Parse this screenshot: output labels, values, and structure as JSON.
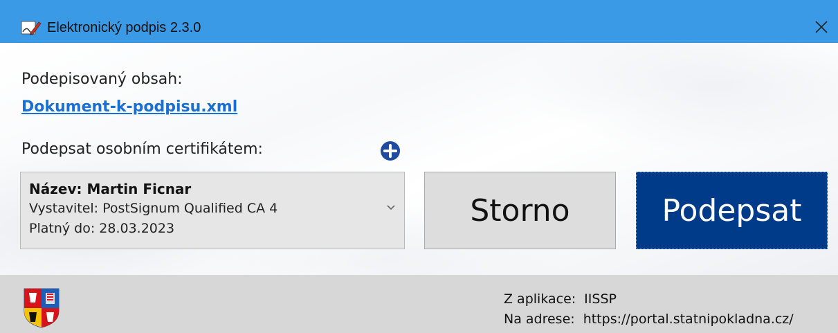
{
  "window": {
    "title": "Elektronický podpis 2.3.0",
    "titlebar_color": "#3b9ae6",
    "app_icon": "signature-pen-icon",
    "close_icon": "close-icon"
  },
  "content": {
    "signed_content_label": "Podepisovaný obsah:",
    "document_link": "Dokument-k-podpisu.xml",
    "certificate_label": "Podepsat osobním certifikátem:",
    "add_certificate_icon": "plus-circle-icon"
  },
  "certificate_select": {
    "name": "Název: Martin Ficnar",
    "issuer": "Vystavitel: PostSignum Qualified CA 4",
    "valid_until": "Platný do: 28.03.2023",
    "dropdown_icon": "chevron-down-icon"
  },
  "buttons": {
    "cancel_label": "Storno",
    "sign_label": "Podepsat",
    "sign_color": "#003b8a"
  },
  "footer": {
    "app_label": "Z aplikace:",
    "app_value": "IISSP",
    "address_label": "Na adrese:",
    "address_value": "https://portal.statnipokladna.cz/",
    "emblem_icon": "czech-coat-of-arms-icon"
  }
}
